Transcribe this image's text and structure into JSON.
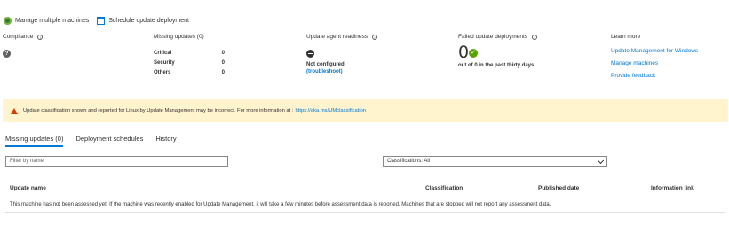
{
  "toolbar": {
    "manage_label": "Manage multiple machines",
    "manage_icon": "gear-icon",
    "schedule_label": "Schedule update deployment",
    "schedule_icon": "calendar-icon"
  },
  "summary": {
    "compliance": {
      "title": "Compliance",
      "status_icon": "question-icon"
    },
    "missing_updates": {
      "title": "Missing updates (0)",
      "rows": [
        {
          "label": "Critical",
          "value": "0"
        },
        {
          "label": "Security",
          "value": "0"
        },
        {
          "label": "Others",
          "value": "0"
        }
      ]
    },
    "agent_readiness": {
      "title": "Update agent readiness",
      "status": "Not configured",
      "troubleshoot": "(troubleshoot)"
    },
    "failed_deployments": {
      "title": "Failed update deployments",
      "count": "0",
      "detail": "out of 0 in the past thirty days"
    },
    "learn_more": {
      "title": "Learn more",
      "links": [
        "Update Management for Windows",
        "Manage machines",
        "Provide feedback"
      ]
    }
  },
  "warning": {
    "text": "Update classification shown and reported for Linux by Update Management may be incorrect. For more information at :",
    "link": "https://aka.ms/UMclassification"
  },
  "tabs": [
    {
      "label": "Missing updates (0)",
      "active": true
    },
    {
      "label": "Deployment schedules",
      "active": false
    },
    {
      "label": "History",
      "active": false
    }
  ],
  "filter": {
    "placeholder": "Filter by name"
  },
  "classifications": {
    "value": "Classifications: All"
  },
  "table": {
    "headers": [
      "Update name",
      "Classification",
      "Published date",
      "Information link"
    ],
    "empty_message": "This machine has not been assessed yet. If the machine was recently enabled for Update Management, it will take a few minutes before assessment data is reported. Machines that are stopped will not report any assessment data."
  },
  "colors": {
    "accent": "#0078d4",
    "warning_bg": "#fff4ce",
    "success": "#57a300"
  }
}
